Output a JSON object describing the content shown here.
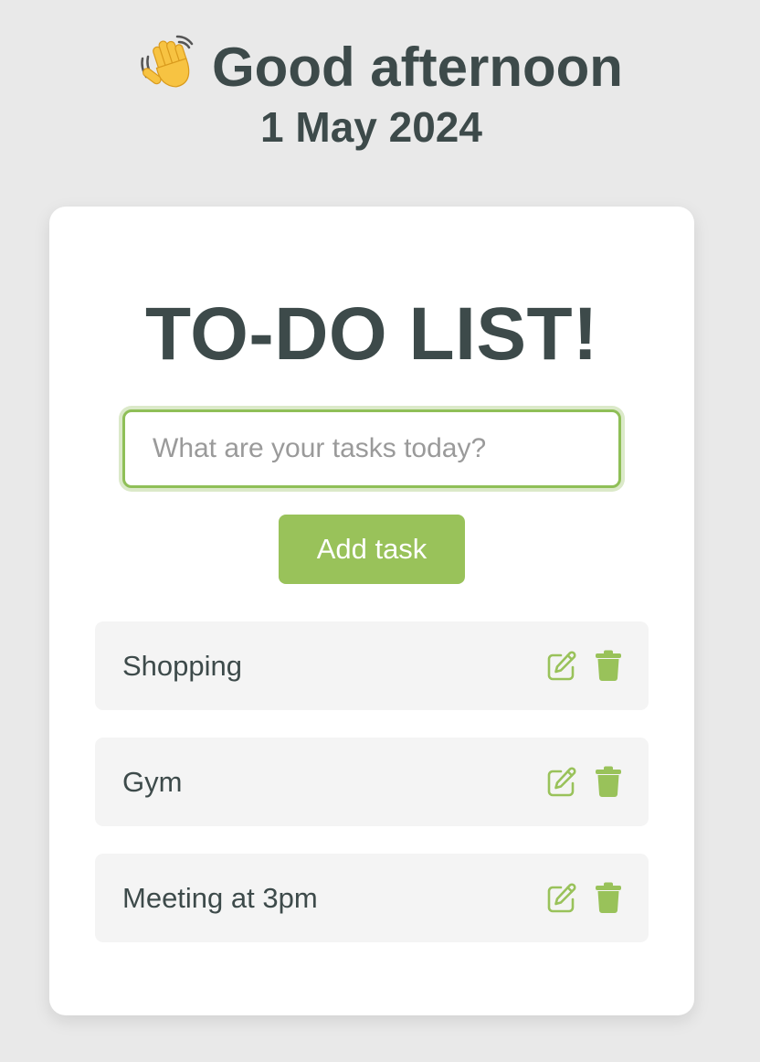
{
  "header": {
    "greeting_icon": "waving-hand-icon",
    "greeting": "Good afternoon",
    "date": "1 May 2024"
  },
  "card": {
    "title": "TO-DO LIST!",
    "input": {
      "placeholder": "What are your tasks today?",
      "value": ""
    },
    "add_button_label": "Add task"
  },
  "tasks": [
    {
      "label": "Shopping",
      "edit_icon": "edit-icon",
      "delete_icon": "trash-icon"
    },
    {
      "label": "Gym",
      "edit_icon": "edit-icon",
      "delete_icon": "trash-icon"
    },
    {
      "label": "Meeting at 3pm",
      "edit_icon": "edit-icon",
      "delete_icon": "trash-icon"
    }
  ],
  "colors": {
    "background": "#e9e9e9",
    "card": "#ffffff",
    "text": "#3d4a4a",
    "accent": "#99c25a",
    "task_background": "#f4f4f4",
    "placeholder": "#9a9a9a"
  }
}
